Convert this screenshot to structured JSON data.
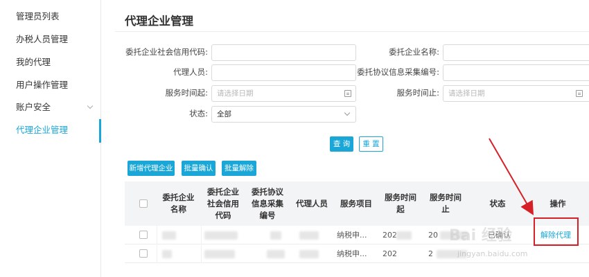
{
  "sidebar": {
    "items": [
      {
        "label": "管理员列表"
      },
      {
        "label": "办税人员管理"
      },
      {
        "label": "我的代理"
      },
      {
        "label": "用户操作管理"
      },
      {
        "label": "账户安全"
      },
      {
        "label": "代理企业管理"
      }
    ]
  },
  "page": {
    "title": "代理企业管理"
  },
  "form": {
    "credit_code_label": "委托企业社会信用代码:",
    "company_name_label": "委托企业名称:",
    "agent_label": "代理人员:",
    "agreement_no_label": "委托协议信息采集编号:",
    "start_label": "服务时间起:",
    "start_placeholder": "请选择日期",
    "end_label": "服务时间止:",
    "end_placeholder": "请选择日期",
    "status_label": "状态:",
    "status_value": "全部"
  },
  "actions": {
    "query": "查 询",
    "reset": "重 置",
    "add": "新增代理企业",
    "batch_confirm": "批量确认",
    "batch_remove": "批量解除"
  },
  "table": {
    "headers": {
      "company": "委托企业名称",
      "credit": "委托企业社会信用代码",
      "agreement": "委托协议信息采集编号",
      "agent": "代理人员",
      "project": "服务项目",
      "start": "服务时间起",
      "end": "服务时间止",
      "status": "状态",
      "op": "操作"
    },
    "rows": [
      {
        "project": "纳税申...",
        "start": "202",
        "end": "20",
        "status": "已确认",
        "op": "解除代理"
      },
      {
        "project": "纳税申...",
        "start": "202",
        "end": "2",
        "status": "",
        "op": ""
      }
    ]
  },
  "watermark": {
    "main": "Bai 经验",
    "sub": "jingyan.baidu.com"
  },
  "colors": {
    "accent": "#1aa7d8",
    "annotation": "#d62027"
  }
}
